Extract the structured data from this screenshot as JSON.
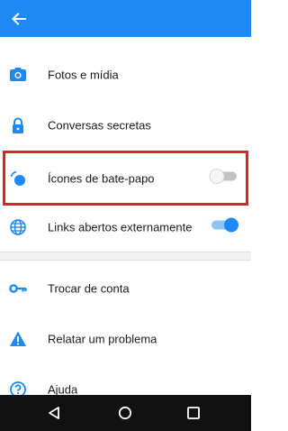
{
  "colors": {
    "accent": "#1e88f5",
    "highlight": "#e0202c",
    "toggle_off_track": "#c2c2c2",
    "toggle_on_track": "#8ec3f7"
  },
  "appbar": {
    "back_icon": "arrow-left-icon"
  },
  "settings": {
    "photos_media": {
      "label": "Fotos e mídia",
      "icon": "camera-icon"
    },
    "secret_conversations": {
      "label": "Conversas secretas",
      "icon": "lock-icon"
    },
    "chat_heads": {
      "label": "Ícones de bate-papo",
      "icon": "chat-heads-icon",
      "toggle": "off"
    },
    "links_external": {
      "label": "Links abertos externamente",
      "icon": "globe-icon",
      "toggle": "on"
    },
    "switch_account": {
      "label": "Trocar de conta",
      "icon": "key-icon"
    },
    "report_problem": {
      "label": "Relatar um problema",
      "icon": "warning-icon"
    },
    "help": {
      "label": "Ajuda",
      "icon": "help-icon"
    }
  },
  "navbar": {
    "icons": [
      "back-triangle-icon",
      "home-circle-icon",
      "recents-square-icon"
    ]
  }
}
